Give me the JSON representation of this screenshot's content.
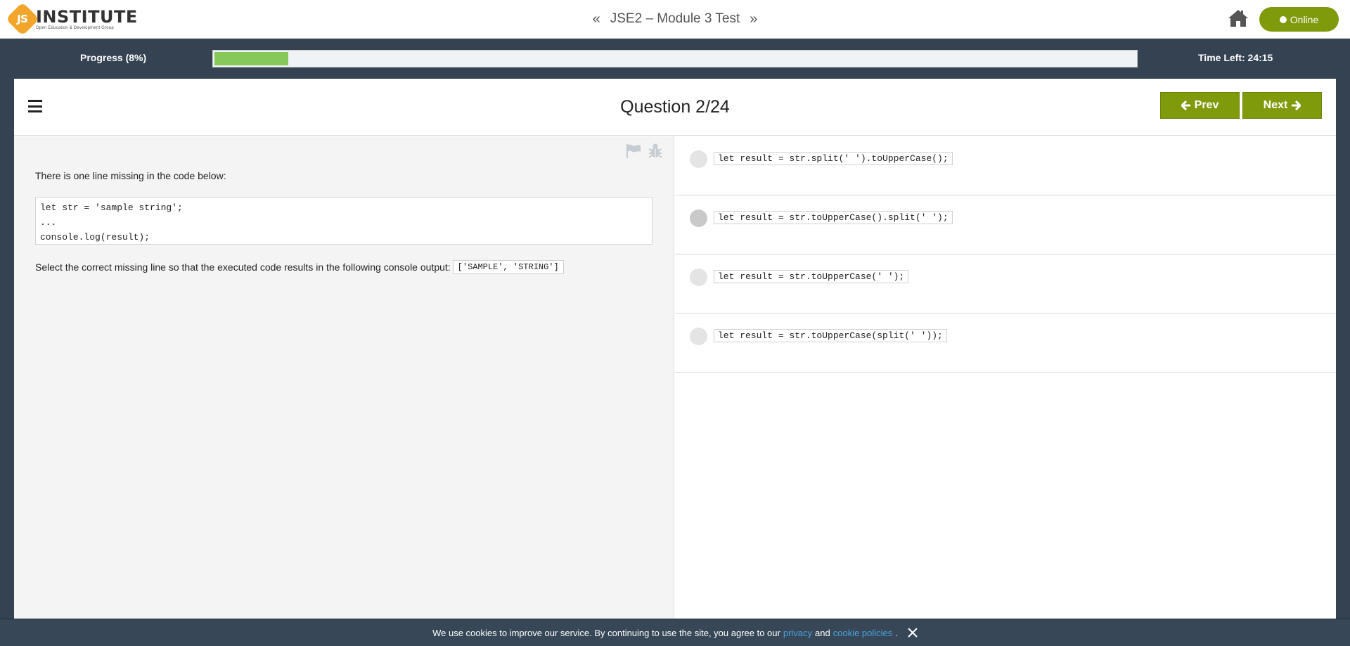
{
  "header": {
    "logo_badge": "JS",
    "logo_title": "INSTITUTE",
    "logo_subtitle": "Open Education & Development Group",
    "test_title": "JSE2 – Module 3 Test",
    "prev_chevron": "«",
    "next_chevron": "»",
    "home_icon": "home-icon",
    "online_label": "Online"
  },
  "progress": {
    "label": "Progress (8%)",
    "percent": 8,
    "time_left": "Time Left: 24:15",
    "fill_color": "#86c95a"
  },
  "question": {
    "title": "Question 2/24",
    "prev_label": "Prev",
    "next_label": "Next",
    "intro": "There is one line missing in the code below:",
    "code_lines": [
      "let str = 'sample string';",
      "...",
      "console.log(result);"
    ],
    "instruction": "Select the correct missing line so that the executed code results in the following console output:",
    "expected_output": "['SAMPLE', 'STRING']",
    "flag_icon": "flag-icon",
    "bug_icon": "bug-icon"
  },
  "options": [
    {
      "code": "let result = str.split(' ').toUpperCase();"
    },
    {
      "code": "let result = str.toUpperCase().split(' ');"
    },
    {
      "code": "let result = str.toUpperCase(' ');"
    },
    {
      "code": "let result = str.toUpperCase(split(' '));"
    }
  ],
  "cookie": {
    "text": "We use cookies to improve our service. By continuing to use the site, you agree to our",
    "privacy_link": "privacy",
    "and": "and",
    "policies_link": "cookie policies",
    "period": ".",
    "close_icon": "close-icon"
  },
  "colors": {
    "accent": "#7f9a0a",
    "dark_bg": "#344252",
    "link": "#4aa3df",
    "logo": "#f3a52b"
  }
}
